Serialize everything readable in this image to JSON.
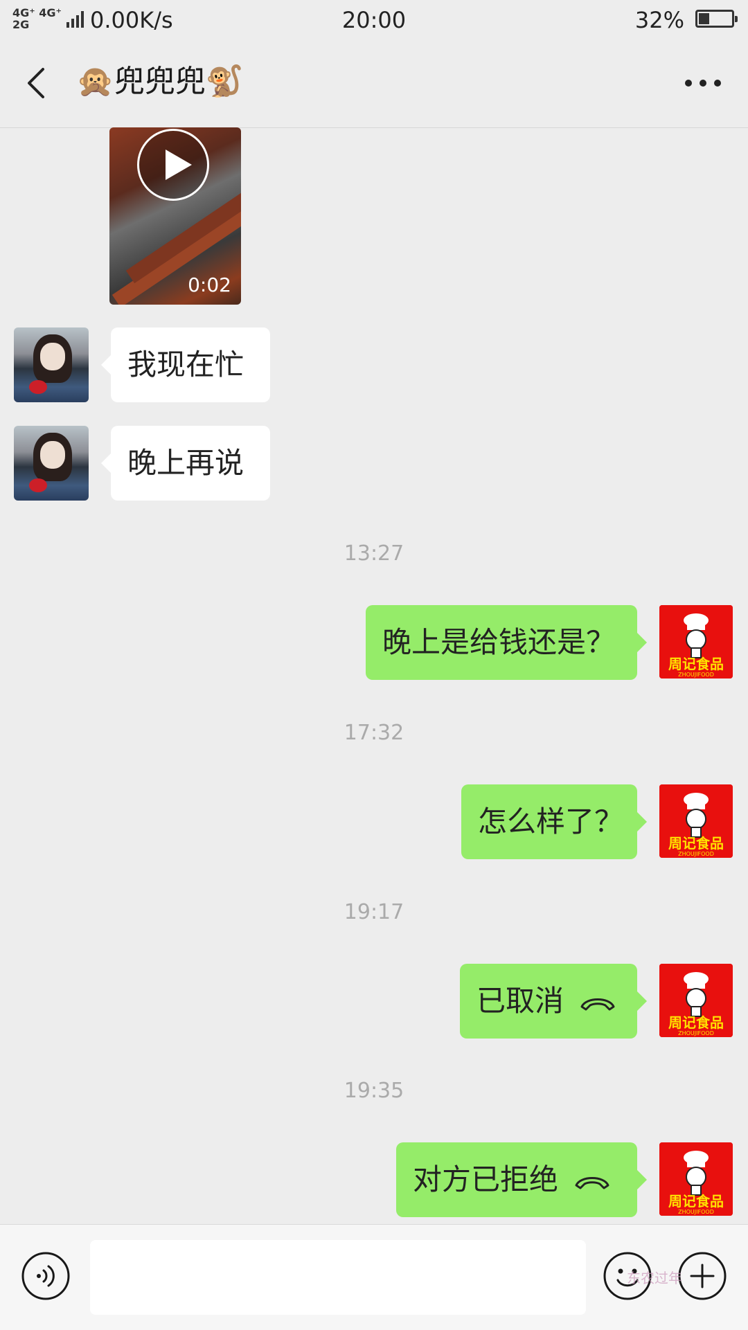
{
  "status_bar": {
    "network_type_top": "4G⁺ 4G⁺",
    "network_type_bottom": "2G",
    "net_speed": "0.00K/s",
    "time": "20:00",
    "battery_percent": "32%",
    "battery_level": 0.32
  },
  "header": {
    "title": "🙊兜兜兜🐒"
  },
  "messages": {
    "video": {
      "duration": "0:02"
    },
    "incoming": [
      {
        "text": "我现在忙"
      },
      {
        "text": "晚上再说"
      }
    ],
    "timestamps": [
      "13:27",
      "17:32",
      "19:17",
      "19:35"
    ],
    "outgoing": [
      {
        "text": "晚上是给钱还是？"
      },
      {
        "text": "怎么样了？"
      },
      {
        "text": "已取消"
      },
      {
        "text": "对方已拒绝"
      }
    ],
    "avatar_label": "周记食品",
    "avatar_sub": "ZHOUJIFOOD"
  },
  "input_bar": {
    "placeholder": ""
  },
  "watermark": "东农过年",
  "colors": {
    "background": "#ededed",
    "outgoing_bubble": "#95ec69",
    "incoming_bubble": "#ffffff",
    "avatar_red": "#e8100e"
  },
  "icons": [
    "back-arrow-icon",
    "more-dots-icon",
    "play-icon",
    "phone-hangup-icon",
    "voice-icon",
    "emoji-icon",
    "plus-icon"
  ]
}
